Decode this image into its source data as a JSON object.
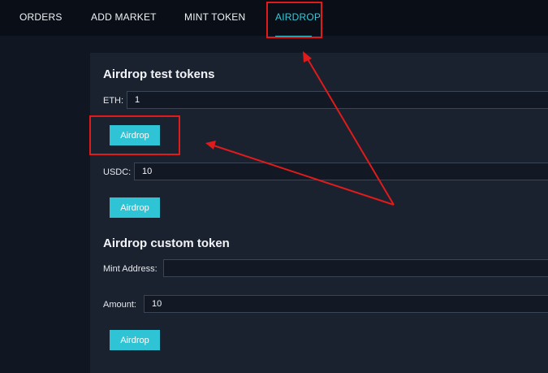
{
  "nav": {
    "items": [
      {
        "label": "ORDERS",
        "active": false
      },
      {
        "label": "ADD MARKET",
        "active": false
      },
      {
        "label": "MINT TOKEN",
        "active": false
      },
      {
        "label": "AIRDROP",
        "active": true
      }
    ]
  },
  "test_tokens": {
    "title": "Airdrop test tokens",
    "eth": {
      "label": "ETH:",
      "value": "1",
      "button_label": "Airdrop"
    },
    "usdc": {
      "label": "USDC:",
      "value": "10",
      "button_label": "Airdrop"
    }
  },
  "custom_token": {
    "title": "Airdrop custom token",
    "mint_address": {
      "label": "Mint Address:",
      "value": ""
    },
    "amount": {
      "label": "Amount:",
      "value": "10"
    },
    "button_label": "Airdrop"
  },
  "colors": {
    "accent": "#2fc3d6",
    "annotation": "#e01b1b",
    "background": "#111722",
    "panel": "#1a2230"
  }
}
